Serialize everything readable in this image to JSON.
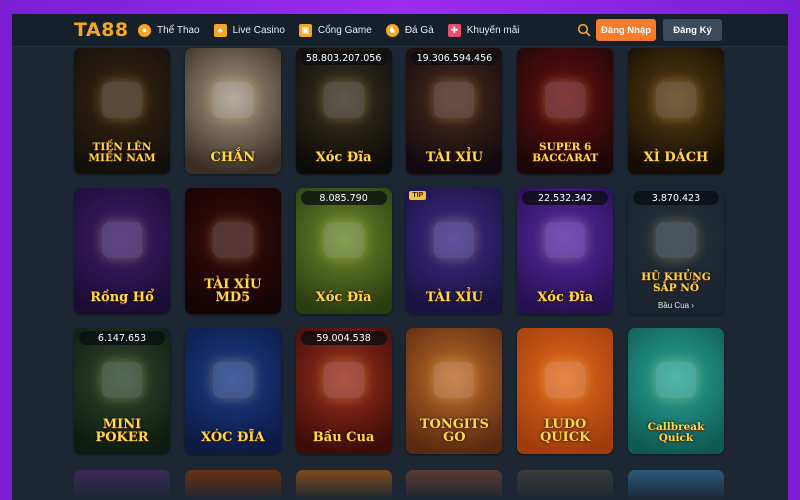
{
  "header": {
    "logo": "TA88",
    "nav": [
      {
        "label": "Thể Thao",
        "icon": "sports-ball-icon",
        "color": "#f5a623"
      },
      {
        "label": "Live Casino",
        "icon": "cards-icon",
        "color": "#f5a623"
      },
      {
        "label": "Cổng Game",
        "icon": "game-box-icon",
        "color": "#f5a623"
      },
      {
        "label": "Đá Gà",
        "icon": "rooster-icon",
        "color": "#f5a623"
      },
      {
        "label": "Khuyến mãi",
        "icon": "gift-icon",
        "color": "#e94d6f"
      }
    ],
    "login": "Đăng Nhập",
    "register": "Đăng Ký"
  },
  "games": [
    {
      "title": "TIẾN LÊN MIỀN NAM",
      "jackpot": "",
      "badge": "",
      "sub": "",
      "bg1": "#3b2510",
      "bg2": "#12100c"
    },
    {
      "title": "CHẮN",
      "jackpot": "",
      "badge": "",
      "sub": "",
      "bg1": "#a59a86",
      "bg2": "#3a2e24"
    },
    {
      "title": "Xóc Đĩa",
      "jackpot": "58.803.207.056",
      "badge": "",
      "sub": "",
      "bg1": "#3a3320",
      "bg2": "#0d0b07"
    },
    {
      "title": "TÀI XỈU",
      "jackpot": "19.306.594.456",
      "badge": "",
      "sub": "",
      "bg1": "#4a2a1a",
      "bg2": "#120a10"
    },
    {
      "title": "SUPER 6 BACCARAT",
      "jackpot": "",
      "badge": "",
      "sub": "",
      "bg1": "#6a1010",
      "bg2": "#1c0608"
    },
    {
      "title": "XÌ DÁCH",
      "jackpot": "",
      "badge": "",
      "sub": "",
      "bg1": "#5a3e12",
      "bg2": "#130d04"
    },
    {
      "title": "Rồng Hổ",
      "jackpot": "",
      "badge": "",
      "sub": "",
      "bg1": "#3c1e6b",
      "bg2": "#1b0c33"
    },
    {
      "title": "TÀI XỈU MD5",
      "jackpot": "",
      "badge": "",
      "sub": "",
      "bg1": "#3a0c0c",
      "bg2": "#140404"
    },
    {
      "title": "Xóc Đĩa",
      "jackpot": "8.085.790",
      "badge": "",
      "sub": "",
      "bg1": "#6e8a2c",
      "bg2": "#2b3d10"
    },
    {
      "title": "TÀI XỈU",
      "jackpot": "",
      "badge": "TIP",
      "sub": "",
      "bg1": "#3e2a8a",
      "bg2": "#1a1240"
    },
    {
      "title": "Xóc Đĩa",
      "jackpot": "22.532.342",
      "badge": "",
      "sub": "",
      "bg1": "#5a2aa8",
      "bg2": "#251050"
    },
    {
      "title": "HŨ KHỦNG SẮP NỔ",
      "jackpot": "3.870.423",
      "badge": "",
      "sub": "Bầu Cua ›",
      "bg1": "#26313d",
      "bg2": "#1a232d"
    },
    {
      "title": "MINI POKER",
      "jackpot": "6.147.653",
      "badge": "",
      "sub": "",
      "bg1": "#2f4a2e",
      "bg2": "#0f1a10"
    },
    {
      "title": "XÓC ĐĨA",
      "jackpot": "",
      "badge": "",
      "sub": "",
      "bg1": "#1e3c8a",
      "bg2": "#0c1a44"
    },
    {
      "title": "Bầu Cua",
      "jackpot": "59.004.538",
      "badge": "",
      "sub": "",
      "bg1": "#a0301c",
      "bg2": "#3c0c08"
    },
    {
      "title": "TONGITS GO",
      "jackpot": "",
      "badge": "",
      "sub": "",
      "bg1": "#c06c2a",
      "bg2": "#5a2a10"
    },
    {
      "title": "LUDO QUICK",
      "jackpot": "",
      "badge": "",
      "sub": "",
      "bg1": "#e06a1c",
      "bg2": "#a03c0c"
    },
    {
      "title": "Callbreak Quick",
      "jackpot": "",
      "badge": "",
      "sub": "",
      "bg1": "#2aa89a",
      "bg2": "#0f5a54"
    }
  ],
  "row4": [
    "#3a2a58",
    "#6a3010",
    "#7a4a1a",
    "#5a3a30",
    "#3a3a3a",
    "#2a5a7a"
  ]
}
